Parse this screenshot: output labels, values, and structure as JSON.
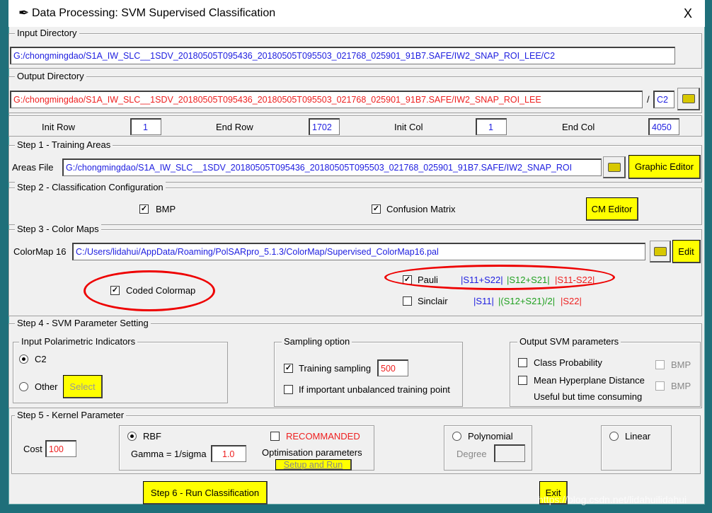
{
  "window": {
    "title": "Data Processing: SVM Supervised Classification",
    "close": "X"
  },
  "input_directory": {
    "label": "Input Directory",
    "value": "G:/chongmingdao/S1A_IW_SLC__1SDV_20180505T095436_20180505T095503_021768_025901_91B7.SAFE/IW2_SNAP_ROI_LEE/C2"
  },
  "output_directory": {
    "label": "Output Directory",
    "value": "G:/chongmingdao/S1A_IW_SLC__1SDV_20180505T095436_20180505T095503_021768_025901_91B7.SAFE/IW2_SNAP_ROI_LEE",
    "separator": "/",
    "subdir": "C2"
  },
  "range": {
    "init_row_label": "Init Row",
    "init_row": "1",
    "end_row_label": "End Row",
    "end_row": "1702",
    "init_col_label": "Init Col",
    "init_col": "1",
    "end_col_label": "End Col",
    "end_col": "4050"
  },
  "step1": {
    "label": "Step 1 - Training Areas",
    "areas_label": "Areas File",
    "areas_value": "G:/chongmingdao/S1A_IW_SLC__1SDV_20180505T095436_20180505T095503_021768_025901_91B7.SAFE/IW2_SNAP_ROI",
    "graphic_editor": "Graphic Editor"
  },
  "step2": {
    "label": "Step 2 - Classification Configuration",
    "bmp": "BMP",
    "bmp_checked": true,
    "confusion": "Confusion Matrix",
    "confusion_checked": true,
    "cm_editor": "CM Editor"
  },
  "step3": {
    "label": "Step 3 - Color Maps",
    "colormap_label": "ColorMap 16",
    "colormap_value": "C:/Users/lidahui/AppData/Roaming/PolSARpro_5.1.3/ColorMap/Supervised_ColorMap16.pal",
    "edit": "Edit",
    "coded": "Coded Colormap",
    "coded_checked": true,
    "pauli": "Pauli",
    "pauli_checked": true,
    "pauli_b": "|S11+S22|",
    "pauli_g": "|S12+S21|",
    "pauli_r": "|S11-S22|",
    "sinclair": "Sinclair",
    "sinclair_checked": false,
    "sinclair_b": "|S11|",
    "sinclair_g": "|(S12+S21)/2|",
    "sinclair_r": "|S22|"
  },
  "step4": {
    "label": "Step 4 - SVM Parameter Setting",
    "indicators": {
      "label": "Input Polarimetric Indicators",
      "c2": "C2",
      "other": "Other",
      "select": "Select"
    },
    "sampling": {
      "label": "Sampling option",
      "training": "Training sampling",
      "training_checked": true,
      "training_value": "500",
      "unbalanced": "If important unbalanced training point"
    },
    "output": {
      "label": "Output SVM parameters",
      "class_prob": "Class Probability",
      "bmp1": "BMP",
      "mean_hyper": "Mean Hyperplane Distance",
      "bmp2": "BMP",
      "note": "Useful but time consuming"
    }
  },
  "step5": {
    "label": "Step 5 - Kernel Parameter",
    "cost_label": "Cost",
    "cost": "100",
    "rbf": "RBF",
    "recommanded": "RECOMMANDED",
    "gamma_label": "Gamma = 1/sigma",
    "gamma": "1.0",
    "optimisation": "Optimisation parameters",
    "setup": "Setup and Run",
    "polynomial": "Polynomial",
    "degree": "Degree",
    "linear": "Linear"
  },
  "footer": {
    "run": "Step 6 - Run Classification",
    "exit": "Exit",
    "watermark": "https://blog.csdn.net/lidahuilidahui"
  },
  "colors": {
    "accent_button": "#ffff00",
    "path_blue": "#2020e0",
    "path_red": "#ee2020",
    "annotation": "#e00000"
  }
}
